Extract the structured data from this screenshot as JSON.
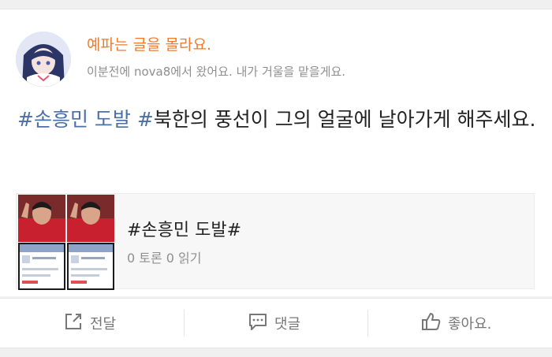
{
  "post": {
    "username": "예파는 글을 몰라요.",
    "meta": "이분전에 nova8에서 왔어요. 내가 거울을 맡을게요.",
    "hashtag1": "#손흥민 도발",
    "hashtag2": "#",
    "body": "북한의 풍선이 그의 얼굴에 날아가게 해주세요."
  },
  "attachment": {
    "title": "#손흥민 도발#",
    "stats": "0 토론 0 읽기"
  },
  "actions": {
    "share": "전달",
    "comment": "댓글",
    "like": "좋아요."
  },
  "colors": {
    "username": "#ef7a2a",
    "hashtag": "#4a6fa7",
    "muted": "#8f8f8f"
  }
}
